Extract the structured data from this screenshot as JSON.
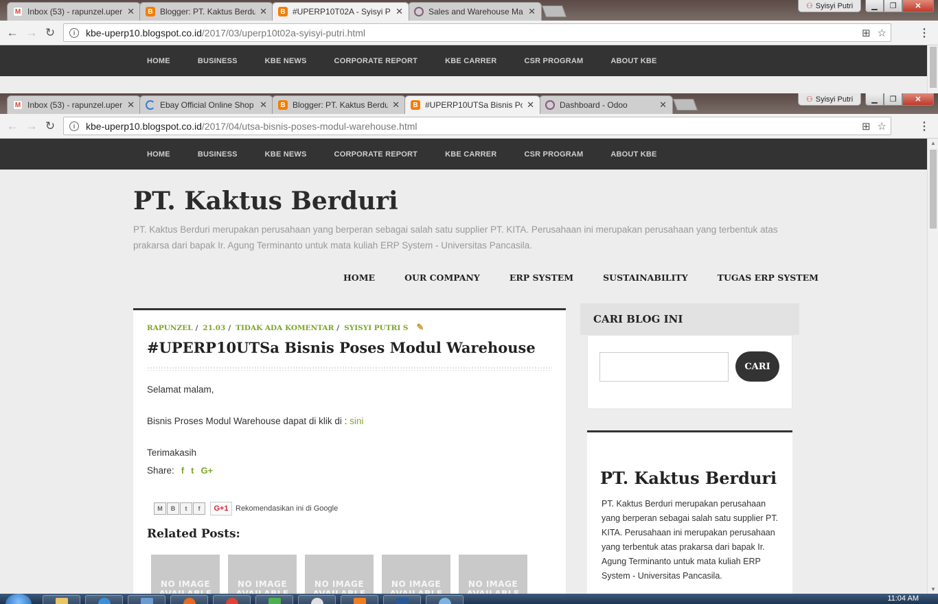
{
  "window1": {
    "tabs": [
      {
        "title": "Inbox (53) - rapunzel.uper",
        "favicon": "gmail-icon",
        "color": "#d44638"
      },
      {
        "title": "Blogger: PT. Kaktus Berdu",
        "favicon": "blogger-icon",
        "color": "#f57d00"
      },
      {
        "title": "#UPERP10T02A - Syisyi P",
        "favicon": "blogger-icon",
        "color": "#f57d00",
        "active": true
      },
      {
        "title": "Sales and Warehouse Ma",
        "favicon": "odoo-icon",
        "color": "#875a7b"
      }
    ],
    "user": "Syisyi Putri",
    "url_host": "kbe-uperp10.blogspot.co.id",
    "url_path": "/2017/03/uperp10t02a-syisyi-putri.html"
  },
  "window2": {
    "tabs": [
      {
        "title": "Inbox (53) - rapunzel.uper",
        "favicon": "gmail-icon",
        "color": "#d44638"
      },
      {
        "title": "Ebay Official Online Shop",
        "favicon": "loading-icon",
        "color": "#3b7bd6"
      },
      {
        "title": "Blogger: PT. Kaktus Berdu",
        "favicon": "blogger-icon",
        "color": "#f57d00"
      },
      {
        "title": "#UPERP10UTSa Bisnis Po",
        "favicon": "blogger-icon",
        "color": "#f57d00",
        "active": true
      },
      {
        "title": "Dashboard - Odoo",
        "favicon": "odoo-icon",
        "color": "#875a7b"
      }
    ],
    "user": "Syisyi Putri",
    "url_host": "kbe-uperp10.blogspot.co.id",
    "url_path": "/2017/04/utsa-bisnis-poses-modul-warehouse.html"
  },
  "topnav": [
    "HOME",
    "BUSINESS",
    "KBE NEWS",
    "CORPORATE REPORT",
    "KBE CARRER",
    "CSR PROGRAM",
    "ABOUT KBE"
  ],
  "blog": {
    "title": "PT. Kaktus Berduri",
    "description": "PT. Kaktus Berduri merupakan perusahaan yang berperan sebagai salah satu supplier PT. KITA. Perusahaan ini merupakan perusahaan yang terbentuk atas prakarsa dari bapak Ir. Agung Terminanto untuk mata kuliah ERP System - Universitas Pancasila."
  },
  "mainnav": [
    "HOME",
    "OUR COMPANY",
    "ERP SYSTEM",
    "SUSTAINABILITY",
    "TUGAS ERP SYSTEM"
  ],
  "post": {
    "author": "RAPUNZEL",
    "time": "21.03",
    "comments": "TIDAK ADA KOMENTAR",
    "label": "SYISYI PUTRI S",
    "title": "#UPERP10UTSa Bisnis Poses Modul Warehouse",
    "greeting": "Selamat malam,",
    "body_text": "Bisnis Proses Modul Warehouse dapat di klik di : ",
    "link_text": "sini",
    "closing": "Terimakasih",
    "share_label": "Share:",
    "share_icons": [
      "f",
      "t",
      "G+"
    ],
    "recommend_text": "Rekomendasikan ini di Google",
    "gplus_label": "G+1",
    "related_title": "Related Posts:",
    "thumb_text": "NO IMAGE AVAILABLE"
  },
  "sidebar": {
    "search_title": "CARI BLOG INI",
    "search_button": "CARI",
    "about_title": "PT. Kaktus Berduri",
    "about_text": "PT. Kaktus Berduri merupakan perusahaan yang berperan sebagai salah satu supplier PT. KITA. Perusahaan ini merupakan perusahaan yang terbentuk atas prakarsa dari bapak Ir. Agung Terminanto untuk mata kuliah ERP System - Universitas Pancasila."
  },
  "taskbar": {
    "clock": "11:04 AM"
  },
  "colors": {
    "accent": "#7fa52a",
    "dark": "#333333"
  }
}
